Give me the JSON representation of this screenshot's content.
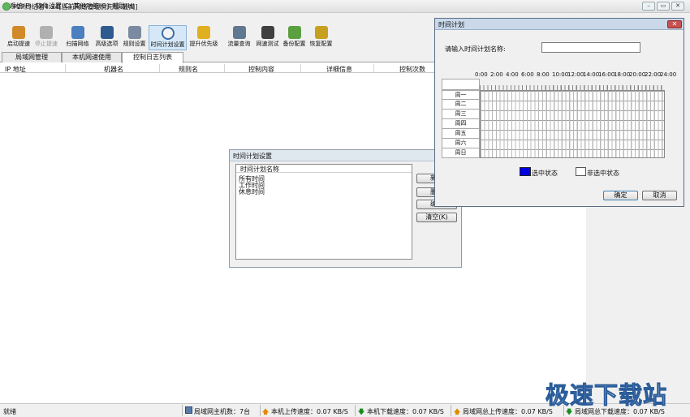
{
  "window": {
    "title": "P2P终结者4.34[当前网络管理优先级:最高]"
  },
  "menu": [
    "系统(F)",
    "软件设置(C)",
    "其他功能(O)",
    "帮助(H)"
  ],
  "toolbar": [
    {
      "label": "启动提速",
      "icon": "start-speedup-icon",
      "color": "#d08a2a",
      "state": "normal"
    },
    {
      "label": "停止提速",
      "icon": "stop-speedup-icon",
      "color": "#b0b0b0",
      "state": "disabled"
    },
    {
      "label": "扫描网络",
      "icon": "scan-network-icon",
      "color": "#4a7fc0",
      "state": "normal"
    },
    {
      "label": "高级选项",
      "icon": "advanced-options-icon",
      "color": "#2e5a90",
      "state": "normal"
    },
    {
      "label": "规则设置",
      "icon": "rules-settings-icon",
      "color": "#7a8aa0",
      "state": "normal"
    },
    {
      "label": "时间计划设置",
      "icon": "clock-icon",
      "color": "#f4f4f4",
      "state": "active"
    },
    {
      "label": "提升优先级",
      "icon": "priority-icon",
      "color": "#e0b020",
      "state": "normal"
    },
    {
      "label": "流量查询",
      "icon": "traffic-query-icon",
      "color": "#607890",
      "state": "normal"
    },
    {
      "label": "网速测试",
      "icon": "speedometer-icon",
      "color": "#404040",
      "state": "normal"
    },
    {
      "label": "备份配置",
      "icon": "backup-icon",
      "color": "#5aa040",
      "state": "normal"
    },
    {
      "label": "恢复配置",
      "icon": "restore-icon",
      "color": "#c8a020",
      "state": "normal"
    }
  ],
  "tabs": [
    "局域网管理",
    "本机网速使用",
    "控制日志列表"
  ],
  "columns": [
    "IP 地址",
    "机器名",
    "规则名",
    "控制内容",
    "详细信息",
    "控制次数"
  ],
  "plan_dialog": {
    "title": "时间计划设置",
    "list_header": "时间计划名称",
    "items": [
      "所有时间",
      "工作时间",
      "休息时间"
    ],
    "buttons": [
      "新建",
      "删除",
      "编辑",
      "清空(K)"
    ]
  },
  "time_dialog": {
    "title": "时间计划",
    "name_label": "请输入时间计划名称:",
    "name_value": "",
    "hours": [
      "0:00",
      "2:00",
      "4:00",
      "6:00",
      "8:00",
      "10:00",
      "12:00",
      "14:00",
      "16:00",
      "18:00",
      "20:00",
      "22:00",
      "24:00"
    ],
    "days": [
      "周一",
      "周二",
      "周三",
      "周四",
      "周五",
      "周六",
      "周日"
    ],
    "legend_selected": "选中状态",
    "legend_unselected": "非选中状态",
    "selected_color": "#0000e0",
    "ok": "确定",
    "cancel": "取消"
  },
  "status": {
    "ready": "就绪",
    "hosts": "局域网主机数：7台",
    "local_up": "本机上传速度：0.07 KB/S",
    "local_down": "本机下载速度：0.07 KB/S",
    "lan_up": "局域网总上传速度：0.07 KB/S",
    "lan_down": "局域网总下载速度：0.07 KB/S"
  },
  "watermark": "极速下载站"
}
